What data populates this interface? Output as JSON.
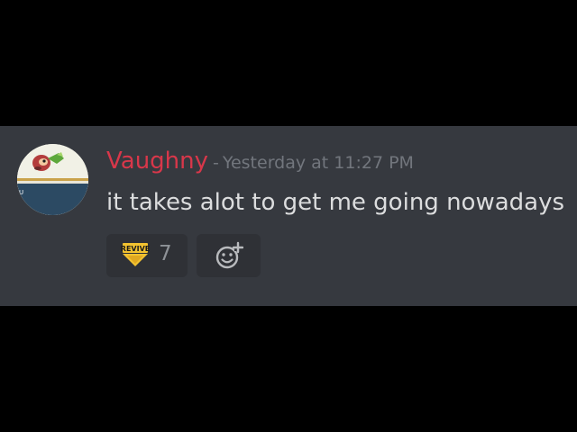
{
  "message": {
    "author": "Vaughny",
    "separator": "-",
    "timestamp": "Yesterday at 11:27 PM",
    "text": "it takes alot to get me going nowadays",
    "author_color": "#d8374a"
  },
  "reactions": [
    {
      "emoji_name": "revive-emoji",
      "emoji_text": "REVIVE",
      "count": "7"
    }
  ],
  "add_reaction": {
    "icon": "add-reaction-icon"
  },
  "colors": {
    "panel_bg": "#36393f",
    "reaction_bg": "#2f3136",
    "timestamp": "#72767d",
    "text": "#dcddde"
  }
}
